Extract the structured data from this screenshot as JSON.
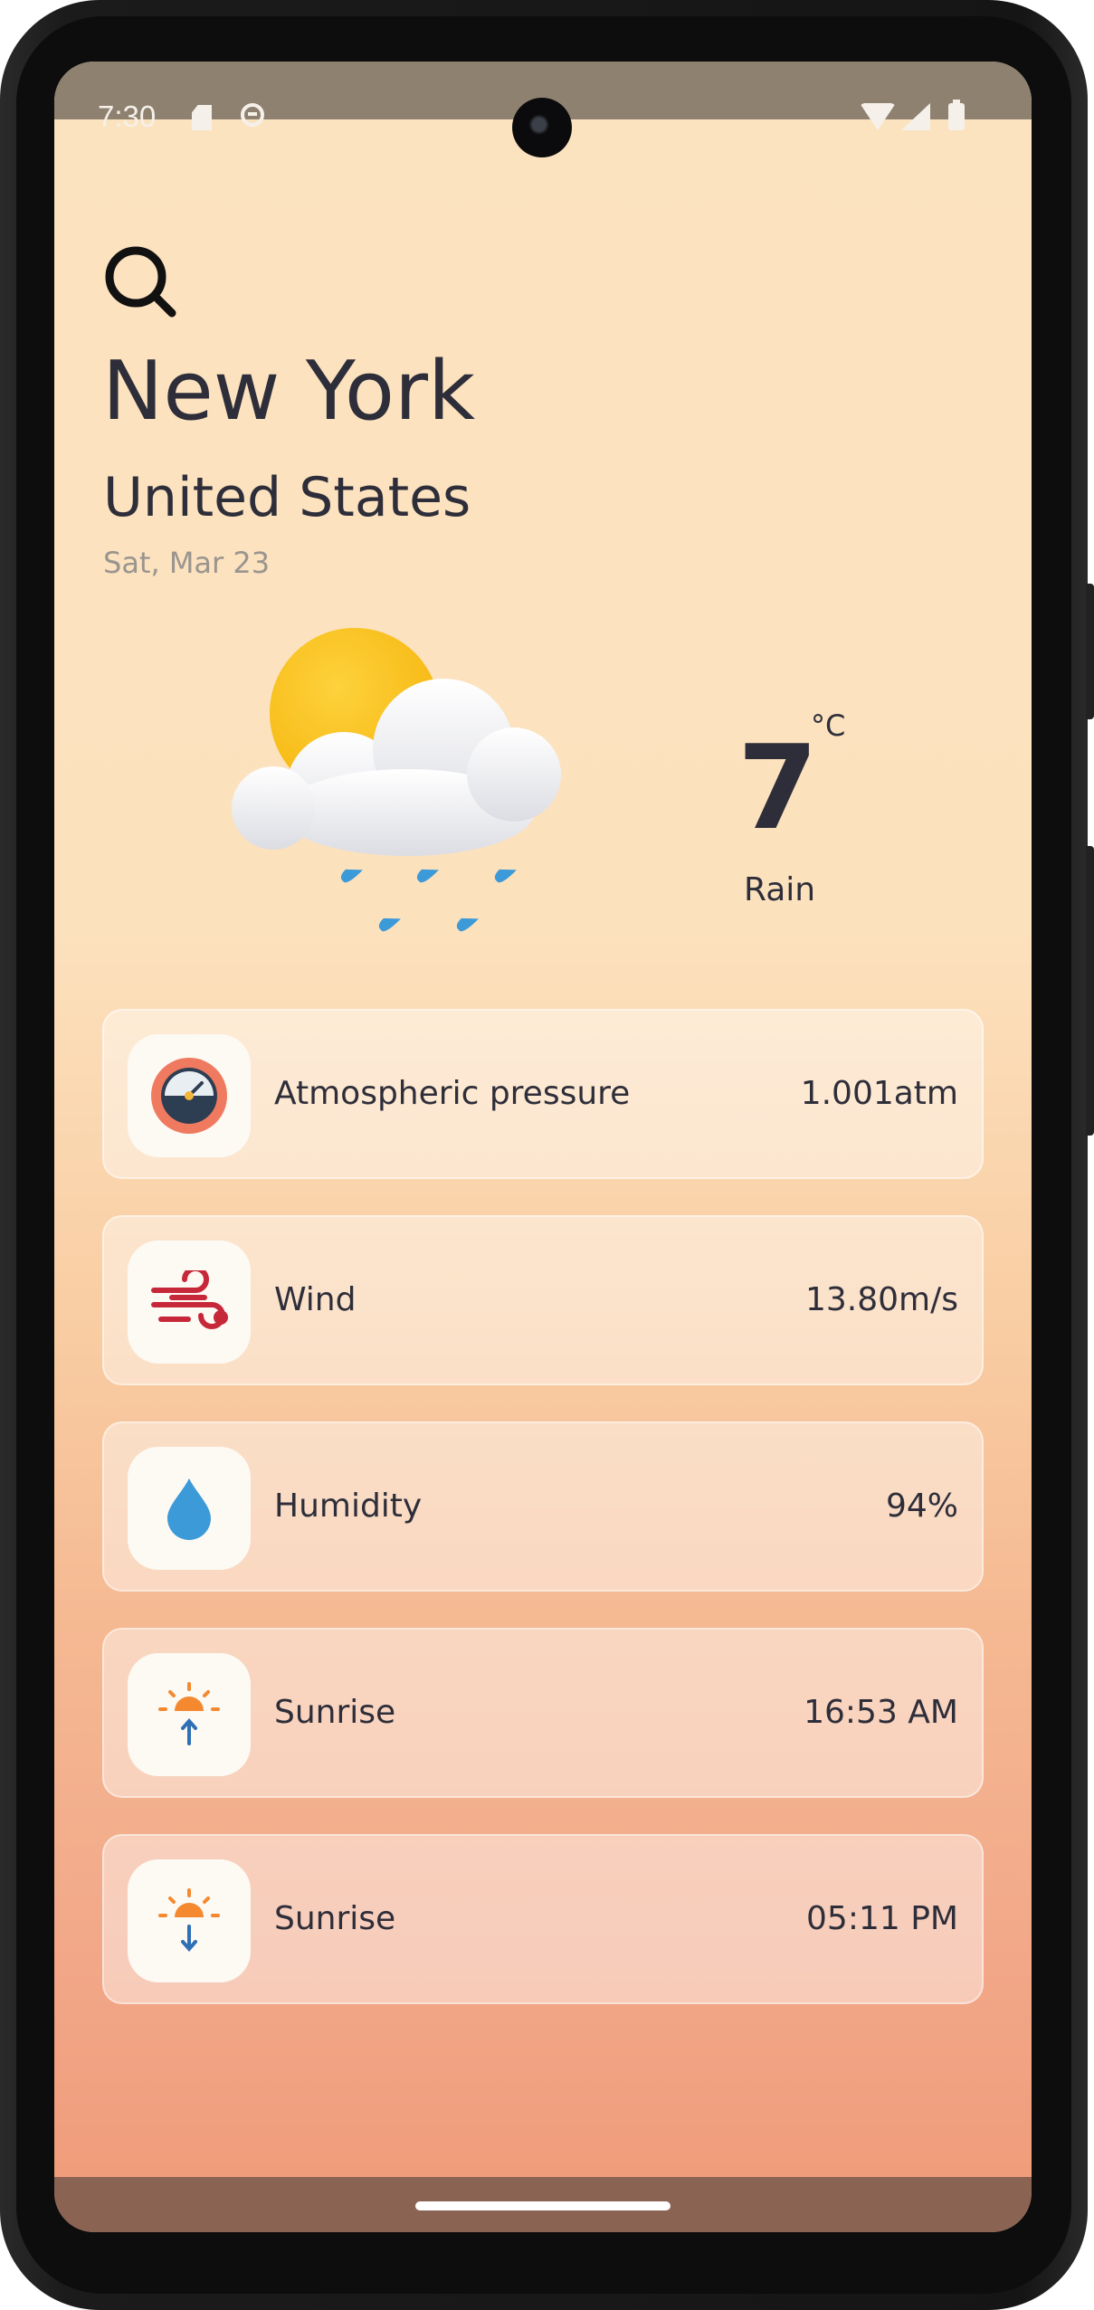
{
  "status_bar": {
    "time": "7:30"
  },
  "header": {
    "city": "New York",
    "country": "United States",
    "date": "Sat, Mar 23"
  },
  "current": {
    "temperature": "7",
    "unit": "°C",
    "condition": "Rain",
    "icon": "sun-cloud-rain-icon"
  },
  "metrics": [
    {
      "label": "Atmospheric pressure",
      "value": "1.001atm",
      "icon": "barometer-icon"
    },
    {
      "label": "Wind",
      "value": "13.80m/s",
      "icon": "wind-icon"
    },
    {
      "label": "Humidity",
      "value": "94%",
      "icon": "water-drop-icon"
    },
    {
      "label": "Sunrise",
      "value": "16:53 AM",
      "icon": "sunrise-icon"
    },
    {
      "label": "Sunrise",
      "value": "05:11 PM",
      "icon": "sunset-icon"
    }
  ],
  "colors": {
    "text_primary": "#2e2e3a",
    "text_secondary": "#9a958f",
    "sun": "#fbc02d",
    "rain": "#3d9ad8",
    "wind": "#c62839",
    "sun_orange": "#f4892f",
    "arrow_blue": "#2f6fb5"
  }
}
